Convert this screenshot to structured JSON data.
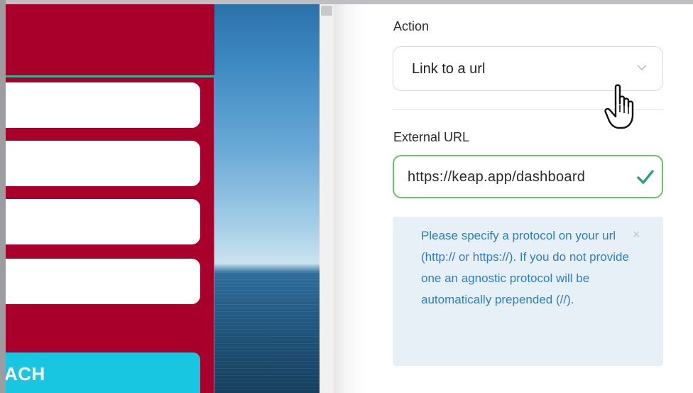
{
  "preview": {
    "cta_label": "ACH"
  },
  "properties": {
    "action": {
      "label": "Action",
      "selected": "Link to a url"
    },
    "external_url": {
      "label": "External URL",
      "value": "https://keap.app/dashboard",
      "valid": true
    },
    "notice": {
      "text": "Please specify a protocol on your url (http:// or https://). If you do not provide one an agnostic protocol will be automatically prepended (//).",
      "close": "×"
    }
  },
  "colors": {
    "form_background": "#a8002b",
    "selection_outline": "#2db596",
    "cta_button": "#19c6e2",
    "valid_border": "#6bbf70",
    "notice_background": "#e8f0f7",
    "notice_text": "#2f7dba"
  },
  "icons": [
    "chevron-down-icon",
    "checkmark-icon",
    "close-icon",
    "hand-pointer-cursor-icon"
  ]
}
